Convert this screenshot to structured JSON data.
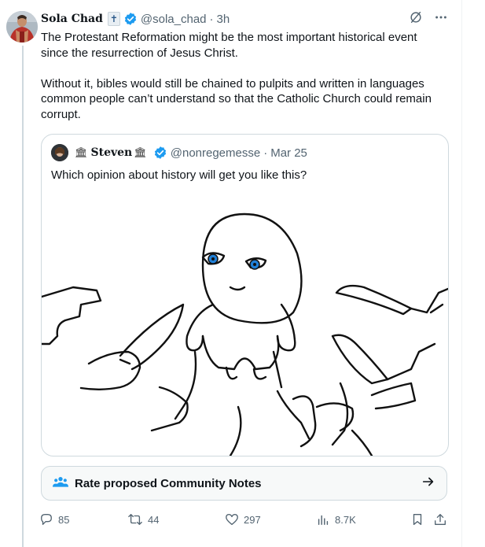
{
  "tweet": {
    "author_name": "Sola Chad",
    "author_handle": "@sola_chad",
    "separator": "·",
    "time": "3h",
    "text": "The Protestant Reformation might be the most important historical event\nsince the resurrection of Jesus Christ.\n\nWithout it, bibles would still be chained to pulpits and written in languages\ncommon people can’t understand so that the Catholic Church could remain\ncorrupt."
  },
  "quote": {
    "author_name": "Steven",
    "author_handle": "@nonregemesse",
    "separator": "·",
    "date": "Mar 25",
    "text": "Which opinion about history will get you like this?"
  },
  "community_notes": {
    "label": "Rate proposed Community Notes"
  },
  "actions": {
    "replies": "85",
    "reposts": "44",
    "likes": "297",
    "views": "8.7K"
  },
  "colors": {
    "verified": "#1d9bf0",
    "muted": "#536471",
    "border": "#cfd9de",
    "eye": "#1f7fd6"
  },
  "icons": [
    "verified-badge-icon",
    "cross-badge-icon",
    "grok-icon",
    "more-icon",
    "bank-icon",
    "community-notes-icon",
    "arrow-right-icon",
    "reply-icon",
    "repost-icon",
    "like-icon",
    "views-icon",
    "bookmark-icon",
    "share-icon"
  ]
}
